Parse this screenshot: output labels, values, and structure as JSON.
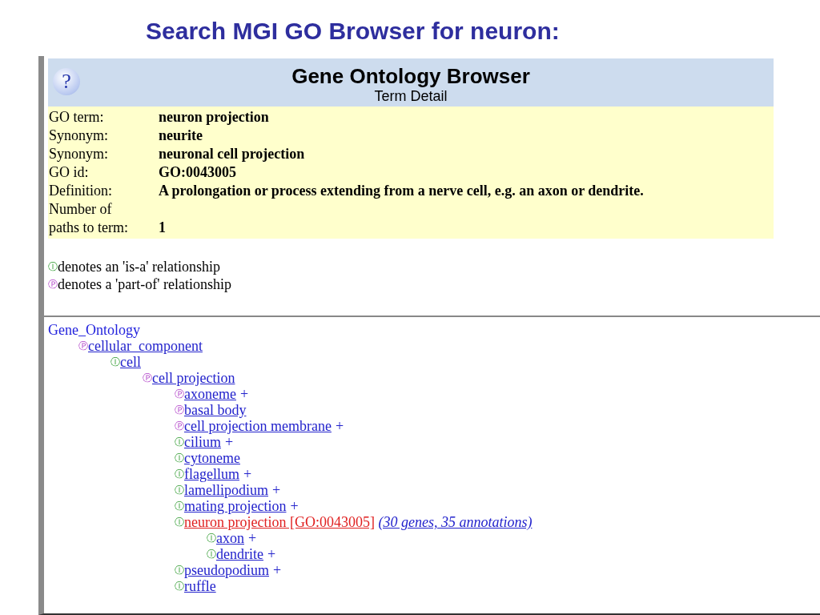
{
  "slide_title": "Search MGI GO Browser for neuron:",
  "header": {
    "help_symbol": "?",
    "title": "Gene Ontology Browser",
    "subtitle": "Term Detail"
  },
  "details": [
    {
      "label": "GO term:",
      "value": "neuron projection"
    },
    {
      "label": "Synonym:",
      "value": "neurite"
    },
    {
      "label": "Synonym:",
      "value": "neuronal cell projection"
    },
    {
      "label": "GO id:",
      "value": "GO:0043005"
    },
    {
      "label": "Definition:",
      "value": "A prolongation or process extending from a nerve cell, e.g. an axon or dendrite."
    },
    {
      "label": "Number of paths to term:",
      "value": "1"
    }
  ],
  "legend": [
    {
      "kind": "is_a",
      "symbol": "Ⓘ",
      "text": "denotes an 'is-a' relationship"
    },
    {
      "kind": "part_of",
      "symbol": "Ⓟ",
      "text": "denotes a 'part-of' relationship"
    }
  ],
  "tree": {
    "label": "Gene_Ontology",
    "children": [
      {
        "kind": "part_of",
        "symbol": "Ⓟ",
        "label": "cellular_component",
        "selected": false,
        "children": [
          {
            "kind": "is_a",
            "symbol": "Ⓘ",
            "label": "cell",
            "selected": false,
            "children": [
              {
                "kind": "part_of",
                "symbol": "Ⓟ",
                "label": "cell projection",
                "selected": false,
                "children": [
                  {
                    "kind": "part_of",
                    "symbol": "Ⓟ",
                    "label": "axoneme",
                    "suffix": "+",
                    "selected": false
                  },
                  {
                    "kind": "part_of",
                    "symbol": "Ⓟ",
                    "label": "basal body",
                    "selected": false
                  },
                  {
                    "kind": "part_of",
                    "symbol": "Ⓟ",
                    "label": "cell projection membrane",
                    "suffix": "+",
                    "selected": false
                  },
                  {
                    "kind": "is_a",
                    "symbol": "Ⓘ",
                    "label": "cilium",
                    "suffix": "+",
                    "selected": false
                  },
                  {
                    "kind": "is_a",
                    "symbol": "Ⓘ",
                    "label": "cytoneme",
                    "selected": false
                  },
                  {
                    "kind": "is_a",
                    "symbol": "Ⓘ",
                    "label": "flagellum",
                    "suffix": "+",
                    "selected": false
                  },
                  {
                    "kind": "is_a",
                    "symbol": "Ⓘ",
                    "label": "lamellipodium",
                    "suffix": "+",
                    "selected": false
                  },
                  {
                    "kind": "is_a",
                    "symbol": "Ⓘ",
                    "label": "mating projection",
                    "suffix": "+",
                    "selected": false
                  },
                  {
                    "kind": "is_a",
                    "symbol": "Ⓘ",
                    "label": "neuron projection [GO:0043005]",
                    "annotations": "(30 genes, 35 annotations)",
                    "selected": true,
                    "children": [
                      {
                        "kind": "is_a",
                        "symbol": "Ⓘ",
                        "label": "axon",
                        "suffix": "+",
                        "selected": false
                      },
                      {
                        "kind": "is_a",
                        "symbol": "Ⓘ",
                        "label": "dendrite",
                        "suffix": "+",
                        "selected": false
                      }
                    ]
                  },
                  {
                    "kind": "is_a",
                    "symbol": "Ⓘ",
                    "label": "pseudopodium",
                    "suffix": "+",
                    "selected": false
                  },
                  {
                    "kind": "is_a",
                    "symbol": "Ⓘ",
                    "label": "ruffle",
                    "selected": false
                  }
                ]
              }
            ]
          }
        ]
      }
    ]
  }
}
